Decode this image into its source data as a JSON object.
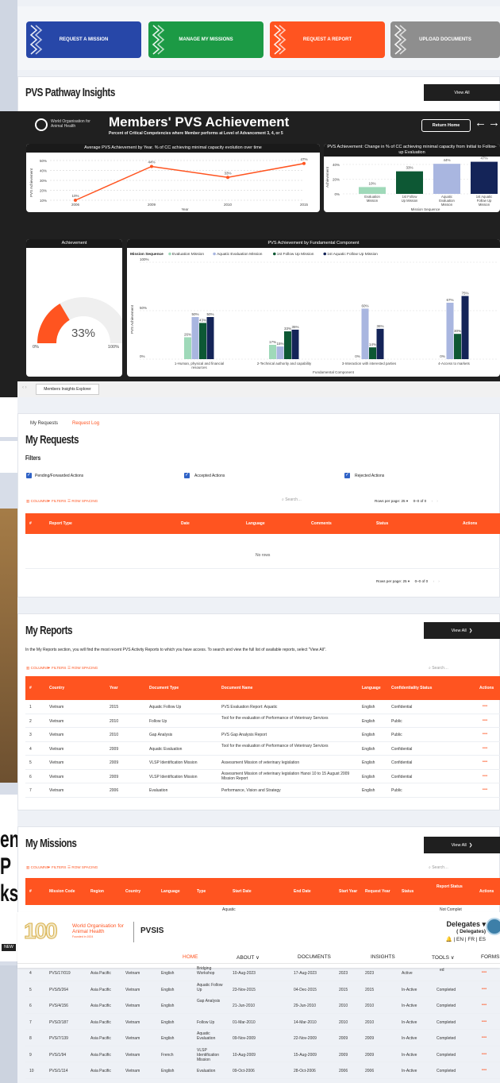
{
  "quick_actions": [
    {
      "label": "REQUEST A MISSION",
      "color": "#2747a8"
    },
    {
      "label": "MANAGE MY MISSIONS",
      "color": "#1c9a45"
    },
    {
      "label": "REQUEST A REPORT",
      "color": "#ff5420"
    },
    {
      "label": "UPLOAD DOCUMENTS",
      "color": "#8e8e8e"
    }
  ],
  "insights": {
    "title": "PVS Pathway Insights",
    "view_all": "View All"
  },
  "dashboard": {
    "org_name": "World Organisation for Animal Health",
    "title": "Members' PVS Achievement",
    "subtitle": "Percent of Critical Competencies where Member performs at Level of Advancement 3, 4, or 5",
    "return_home": "Return Home",
    "back_arrow": "←",
    "fwd_arrow": "→",
    "explorer_tab": "Members Insights Explorer"
  },
  "chart_data": [
    {
      "type": "line",
      "title": "Average PVS Achievement by Year. % of CC achieving minimal capacity evolution over time",
      "xlabel": "Year",
      "ylabel": "PVS Achievement",
      "x": [
        "2006",
        "2009",
        "2010",
        "2015"
      ],
      "values": [
        10,
        44,
        33,
        47
      ],
      "labels": [
        "10%",
        "44%",
        "33%",
        "47%"
      ],
      "ylim": [
        10,
        50
      ],
      "yticks": [
        "50%",
        "40%",
        "30%",
        "20%",
        "10%"
      ],
      "color": "#ff5420"
    },
    {
      "type": "bar",
      "title": "PVS Achievement: Change in % of CC achieving minimal capacity from Initial to Follow-up Evaluation",
      "xlabel": "Mission Sequence",
      "ylabel": "Achievement",
      "categories": [
        "Evaluation Mission",
        "1st Follow Up Mission",
        "Aquatic Evaluation Mission",
        "1st Aquatic Follow Up Mission"
      ],
      "values": [
        10,
        33,
        44,
        47
      ],
      "labels": [
        "10%",
        "33%",
        "44%",
        "47%"
      ],
      "ylim": [
        0,
        50
      ],
      "yticks": [
        "40%",
        "20%",
        "0%"
      ],
      "colors": [
        "#9fd9b9",
        "#0d5834",
        "#a9b6e0",
        "#142458"
      ]
    },
    {
      "type": "gauge",
      "title": "Achievement",
      "value": 33,
      "label": "33%",
      "min_label": "0%",
      "max_label": "100%",
      "color": "#ff5420"
    },
    {
      "type": "bar",
      "title": "PVS Achievement by Fundamental Component",
      "legend_title": "Mission Sequence",
      "xlabel": "Fundamental Component",
      "ylabel": "PVS Achievement",
      "categories": [
        "1-Human, physical and financial resources",
        "2-Technical authority and capability",
        "3-Interaction with interested parties",
        "4-Access to markets"
      ],
      "series": [
        {
          "name": "Evaluation Mission",
          "color": "#9fd9b9",
          "values": [
            26,
            17,
            0,
            0
          ],
          "labels": [
            "26%",
            "17%",
            "0%",
            "0%"
          ]
        },
        {
          "name": "Aquatic Evaluation Mission",
          "color": "#a9b6e0",
          "values": [
            50,
            15,
            60,
            67
          ],
          "labels": [
            "50%",
            "15%",
            "60%",
            "67%"
          ]
        },
        {
          "name": "1st Follow Up Mission",
          "color": "#0d5834",
          "values": [
            43,
            33,
            14,
            30
          ],
          "labels": [
            "43%",
            "33%",
            "14%",
            "30%"
          ]
        },
        {
          "name": "1st Aquatic Follow Up Mission",
          "color": "#142458",
          "values": [
            50,
            35,
            36,
            75
          ],
          "labels": [
            "50%",
            "35%",
            "36%",
            "75%"
          ]
        }
      ],
      "ylim": [
        0,
        100
      ],
      "yticks": [
        "100%",
        "50%",
        "0%"
      ]
    }
  ],
  "requests": {
    "tabs": [
      "My Requests",
      "Request Log"
    ],
    "title": "My Requests",
    "filters_label": "Filters",
    "filters": [
      "Pending/Forwarded Actions",
      "Accepted Actions",
      "Rejected Actions"
    ],
    "toolbar": {
      "columns": "COLUMNS",
      "filters": "FILTERS",
      "row_spacing": "ROW SPACING"
    },
    "search_placeholder": "Search…",
    "rows_per_page_label": "Rows per page:",
    "rows_per_page": "25",
    "range": "0–0 of 0",
    "headers": [
      "#",
      "Report Type",
      "Date",
      "Language",
      "Comments",
      "Status",
      "Actions"
    ],
    "empty": "No rows"
  },
  "reports": {
    "title": "My Reports",
    "view_all": "View All",
    "description": "In the My Reports section, you will find the most recent PVS Activity Reports to which you have access. To search and view the full list of available reports, select \"View All\".",
    "search_placeholder": "Search…",
    "headers": [
      "#",
      "Country",
      "Year",
      "Document Type",
      "Document Name",
      "Language",
      "Confidentiality Status",
      "Actions"
    ],
    "rows": [
      [
        "1",
        "Vietnam",
        "2015",
        "Aquatic Follow Up",
        "PVS Evaluation Report: Aquatic",
        "English",
        "Confidential"
      ],
      [
        "2",
        "Vietnam",
        "2010",
        "Follow Up",
        "Tool for the evaluation of Performance of Veterinary Services",
        "English",
        "Public"
      ],
      [
        "3",
        "Vietnam",
        "2010",
        "Gap Analysis",
        "PVS Gap Analysis Report",
        "English",
        "Public"
      ],
      [
        "4",
        "Vietnam",
        "2009",
        "Aquatic Evaluation",
        "Tool for the evaluation of Performance of Veterinary Services",
        "English",
        "Confidential"
      ],
      [
        "5",
        "Vietnam",
        "2009",
        "VLSP Identification Mission",
        "Assessment Mission of veterinary legislation",
        "English",
        "Confidential"
      ],
      [
        "6",
        "Vietnam",
        "2009",
        "VLSP Identification Mission",
        "Assessment Mission of veterinary legislation Hanoi 10 to 15 August 2009 Mission Report",
        "English",
        "Confidential"
      ],
      [
        "7",
        "Vietnam",
        "2006",
        "Evaluation",
        "Performance, Vision and Strategy",
        "English",
        "Public"
      ]
    ],
    "action_glyph": "•••"
  },
  "missions": {
    "title": "My Missions",
    "view_all": "View All",
    "search_placeholder": "Search…",
    "headers": [
      "#",
      "Mission Code",
      "Region",
      "Country",
      "Language",
      "Type",
      "Start Date",
      "End Date",
      "Start Year",
      "Request Year",
      "Status",
      "Report Status",
      "Actions"
    ],
    "partial_row": {
      "type": "Aquatic",
      "report_status": "Not Complet"
    },
    "partial_row4_status": "ed",
    "rows": [
      [
        "4",
        "PVS/17/019",
        "Asia Pacific",
        "Vietnam",
        "English",
        "Bridging Workshop",
        "10-Aug-2023",
        "17-Aug-2023",
        "2023",
        "2023",
        "Active",
        ""
      ],
      [
        "5",
        "PVS/5/264",
        "Asia Pacific",
        "Vietnam",
        "English",
        "Aquatic Follow Up",
        "23-Nov-2015",
        "04-Dec-2015",
        "2015",
        "2015",
        "In-Active",
        "Completed"
      ],
      [
        "6",
        "PVS/4/156",
        "Asia Pacific",
        "Vietnam",
        "English",
        "Gap Analysis",
        "21-Jun-2010",
        "29-Jun-2010",
        "2010",
        "2010",
        "In-Active",
        "Completed"
      ],
      [
        "7",
        "PVS/2/187",
        "Asia Pacific",
        "Vietnam",
        "English",
        "Follow Up",
        "01-Mar-2010",
        "14-Mar-2010",
        "2010",
        "2010",
        "In-Active",
        "Completed"
      ],
      [
        "8",
        "PVS/7/139",
        "Asia Pacific",
        "Vietnam",
        "English",
        "Aquatic Evaluation",
        "09-Nov-2009",
        "22-Nov-2009",
        "2009",
        "2009",
        "In-Active",
        "Completed"
      ],
      [
        "9",
        "PVS/1/94",
        "Asia Pacific",
        "Vietnam",
        "French",
        "VLSP Identification Mission",
        "10-Aug-2009",
        "15-Aug-2009",
        "2009",
        "2009",
        "In-Active",
        "Completed"
      ],
      [
        "10",
        "PVS/1/114",
        "Asia Pacific",
        "Vietnam",
        "English",
        "Evaluation",
        "09-Oct-2006",
        "28-Oct-2006",
        "2006",
        "2006",
        "In-Active",
        "Completed"
      ]
    ],
    "action_glyph": "•••"
  },
  "header": {
    "logo_number": "100",
    "org_name": "World Organisation for Animal Health",
    "org_founded": "Founded in 1924",
    "app_name": "PVSIS",
    "user_name": "Delegates ▾",
    "user_role": "( Delegates)",
    "languages": "🔔 | EN | FR | ES",
    "nav": [
      "HOME",
      "ABOUT ∨",
      "DOCUMENTS",
      "INSIGHTS",
      "TOOLS ∨",
      "FORMS"
    ],
    "accent": "#ff5420"
  },
  "background_fragments": {
    "letters": [
      "en",
      "P",
      "ks"
    ],
    "badge": "NEW"
  }
}
